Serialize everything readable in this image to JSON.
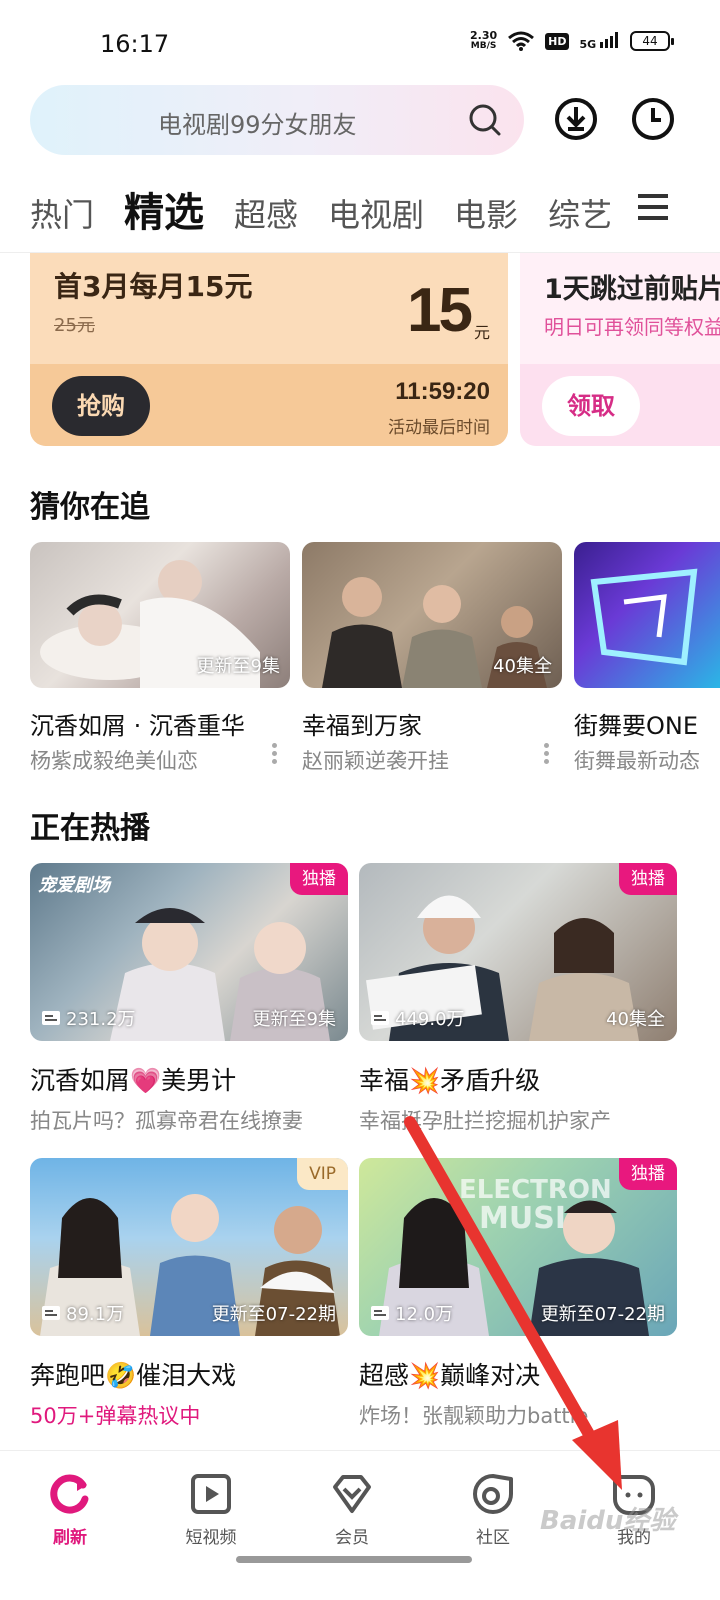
{
  "status_bar": {
    "time": "16:17",
    "net_speed": "2.30",
    "net_unit": "MB/S",
    "hd": "HD",
    "signal": "5G",
    "battery": "44"
  },
  "header": {
    "search_placeholder": "电视剧99分女朋友"
  },
  "tabs": [
    "热门",
    "精选",
    "超感",
    "电视剧",
    "电影",
    "综艺"
  ],
  "active_tab": "精选",
  "promos": [
    {
      "title": "首3月每月15元",
      "old_price": "25元",
      "price": "15",
      "price_unit": "元",
      "button": "抢购",
      "countdown": "11:59:20",
      "countdown_label": "活动最后时间"
    },
    {
      "title": "1天跳过前贴片",
      "subtitle": "明日可再领同等权益",
      "button": "领取"
    }
  ],
  "guess_section": {
    "title": "猜你在追",
    "items": [
      {
        "badge": "更新至9集",
        "title": "沉香如屑 · 沉香重华",
        "subtitle": "杨紫成毅绝美仙恋"
      },
      {
        "badge": "40集全",
        "title": "幸福到万家",
        "subtitle": "赵丽颖逆袭开挂"
      },
      {
        "badge": "",
        "title": "街舞要ONE",
        "subtitle": "街舞最新动态"
      }
    ]
  },
  "hot_section": {
    "title": "正在热播",
    "items": [
      {
        "tag": "独播",
        "views": "231.2万",
        "episodes": "更新至9集",
        "title": "沉香如屑💗美男计",
        "subtitle": "拍瓦片吗？孤寡帝君在线撩妻",
        "brand": "宠爱剧场"
      },
      {
        "tag": "独播",
        "views": "449.0万",
        "episodes": "40集全",
        "title": "幸福💥矛盾升级",
        "subtitle": "幸福挺孕肚拦挖掘机护家产"
      },
      {
        "tag": "VIP",
        "views": "89.1万",
        "episodes": "更新至07-22期",
        "title": "奔跑吧🤣催泪大戏",
        "subtitle": "50万+弹幕热议中"
      },
      {
        "tag": "独播",
        "views": "12.0万",
        "episodes": "更新至07-22期",
        "title": "超感💥巅峰对决",
        "subtitle": "炸场！张靓颖助力battle"
      }
    ]
  },
  "bottom_nav": [
    {
      "label": "刷新",
      "icon": "refresh-icon",
      "active": true
    },
    {
      "label": "短视频",
      "icon": "short-video-icon"
    },
    {
      "label": "会员",
      "icon": "vip-diamond-icon"
    },
    {
      "label": "社区",
      "icon": "community-icon"
    },
    {
      "label": "我的",
      "icon": "profile-icon"
    }
  ],
  "colors": {
    "accent": "#e0197d",
    "promo_gold": "#fbdcba",
    "annotation_arrow": "#e8342f"
  },
  "watermark": "Baidu经验"
}
